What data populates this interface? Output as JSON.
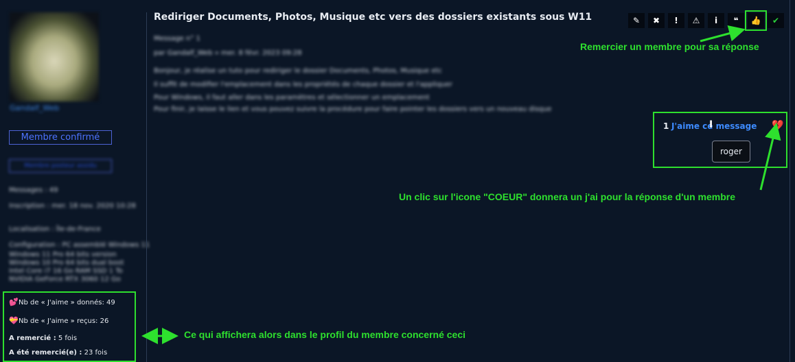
{
  "post": {
    "title": "Rediriger Documents, Photos, Musique etc vers des dossiers existants sous W11",
    "meta_message": "Message n° 1",
    "meta_author": "par Gandalf_Web » mer. 8 févr. 2023 09:28",
    "body_lines": [
      "Bonjour, je réalise un tuto pour rediriger le dossier Documents, Photos, Musique etc",
      "Il suffit de modifier l'emplacement dans les propriétés de chaque dossier et l'appliquer",
      "Pour Windows, il faut aller dans les paramètres et sélectionner un emplacement",
      "Pour finir, je laisse le lien et vous pouvez suivre la procédure pour faire pointer les dossiers vers un nouveau disque"
    ]
  },
  "toolbar": {
    "icons": [
      "pencil-icon",
      "close-icon",
      "report-icon",
      "warning-icon",
      "info-icon",
      "quote-icon",
      "thumbs-up-icon",
      "check-icon"
    ],
    "glyphs": [
      "✎",
      "✖",
      "!",
      "⚠",
      "i",
      "❝",
      "👍",
      "✔"
    ]
  },
  "like": {
    "count": "1",
    "label": "J'aime ce message",
    "heart_glyph": "💔",
    "cursor_glyph": "I",
    "user": "roger"
  },
  "profile": {
    "username": "Gandalf_Web",
    "rank1": "Membre confirmé",
    "rank2": "Membre posteur assidu",
    "messages_label": "Messages : 49",
    "inscription_label": "Inscription : mer. 18 nov. 2020 10:28",
    "localisation_label": "Localisation : Île-de-France",
    "config_label": "Configuration : PC assemblé Windows 11",
    "config_lines": [
      "Windows 11 Pro 64 bits version",
      "Windows 10 Pro 64 bits dual boot",
      "Intel Core i7 16 Go RAM SSD 1 To",
      "NVIDIA GeForce RTX 3060 12 Go"
    ],
    "stats": {
      "likes_given_label": "Nb de « J'aime » donnés:",
      "likes_given_value": "49",
      "likes_received_label": "Nb de « J'aime » reçus:",
      "likes_received_value": "26",
      "thanked_label": "A remercié :",
      "thanked_value": "5 fois",
      "was_thanked_label": "A été remercié(e) :",
      "was_thanked_value": "23 fois"
    }
  },
  "annotations": {
    "thank": "Remercier un membre pour sa réponse",
    "heart": "Un clic sur l'icone \"COEUR\" donnera un j'ai pour la réponse d'un membre",
    "profile": "Ce qui affichera alors dans le profil du membre concerné ceci"
  },
  "colors": {
    "annotation_green": "#2ee02e",
    "link_blue": "#3d8bff",
    "background": "#0b1626"
  }
}
